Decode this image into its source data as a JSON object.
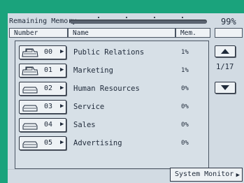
{
  "memory": {
    "label": "Remaining Memory:",
    "percent": "99%",
    "remaining_fraction": 0.99
  },
  "table": {
    "headers": [
      "Number",
      "Name",
      "Mem."
    ],
    "rows": [
      {
        "number": "00",
        "name": "Public Relations",
        "mem": "1%"
      },
      {
        "number": "01",
        "name": "Marketing",
        "mem": "1%"
      },
      {
        "number": "02",
        "name": "Human Resources",
        "mem": "0%"
      },
      {
        "number": "03",
        "name": "Service",
        "mem": "0%"
      },
      {
        "number": "04",
        "name": "Sales",
        "mem": "0%"
      },
      {
        "number": "05",
        "name": "Advertising",
        "mem": "0%"
      }
    ]
  },
  "pagination": {
    "indicator": "1/17"
  },
  "footer": {
    "system_monitor_label": "System Monitor"
  },
  "icons": {
    "row_icon": "printer-icon",
    "row_arrow": "triangle-right-icon",
    "scroll_up": "triangle-up-icon",
    "scroll_down": "triangle-down-icon"
  },
  "colors": {
    "bezel": "#1aa37c",
    "screen": "#d2dbe3",
    "button_face": "#eef2f5",
    "text": "#1f2a3a"
  }
}
